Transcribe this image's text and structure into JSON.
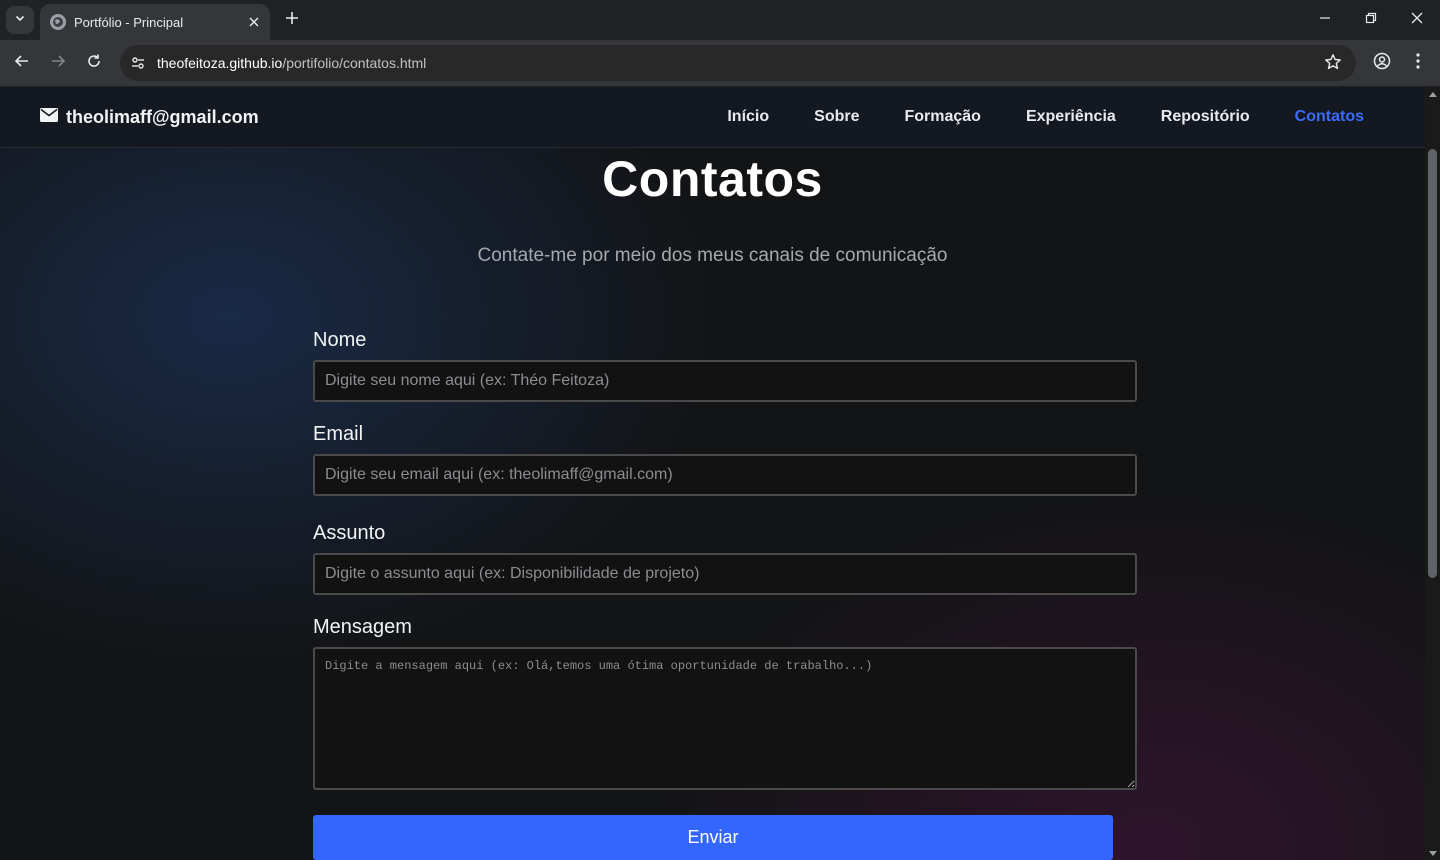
{
  "browser": {
    "tab_title": "Portfólio - Principal",
    "url_host": "theofeitoza.github.io",
    "url_path": "/portifolio/contatos.html"
  },
  "header": {
    "email": "theolimaff@gmail.com",
    "nav": [
      {
        "label": "Início",
        "active": false
      },
      {
        "label": "Sobre",
        "active": false
      },
      {
        "label": "Formação",
        "active": false
      },
      {
        "label": "Experiência",
        "active": false
      },
      {
        "label": "Repositório",
        "active": false
      },
      {
        "label": "Contatos",
        "active": true
      }
    ]
  },
  "main": {
    "title": "Contatos",
    "subtitle": "Contate-me por meio dos meus canais de comunicação",
    "form": {
      "name_label": "Nome",
      "name_placeholder": "Digite seu nome aqui (ex: Théo Feitoza)",
      "email_label": "Email",
      "email_placeholder": "Digite seu email aqui (ex: theolimaff@gmail.com)",
      "subject_label": "Assunto",
      "subject_placeholder": "Digite o assunto aqui (ex: Disponibilidade de projeto)",
      "message_label": "Mensagem",
      "message_placeholder": "Digite a mensagem aqui (ex: Olá,temos uma ótima oportunidade de trabalho...)",
      "submit_label": "Enviar"
    }
  },
  "colors": {
    "accent": "#3366ff",
    "nav_active": "#3a6bff",
    "header_bg": "#141820"
  }
}
